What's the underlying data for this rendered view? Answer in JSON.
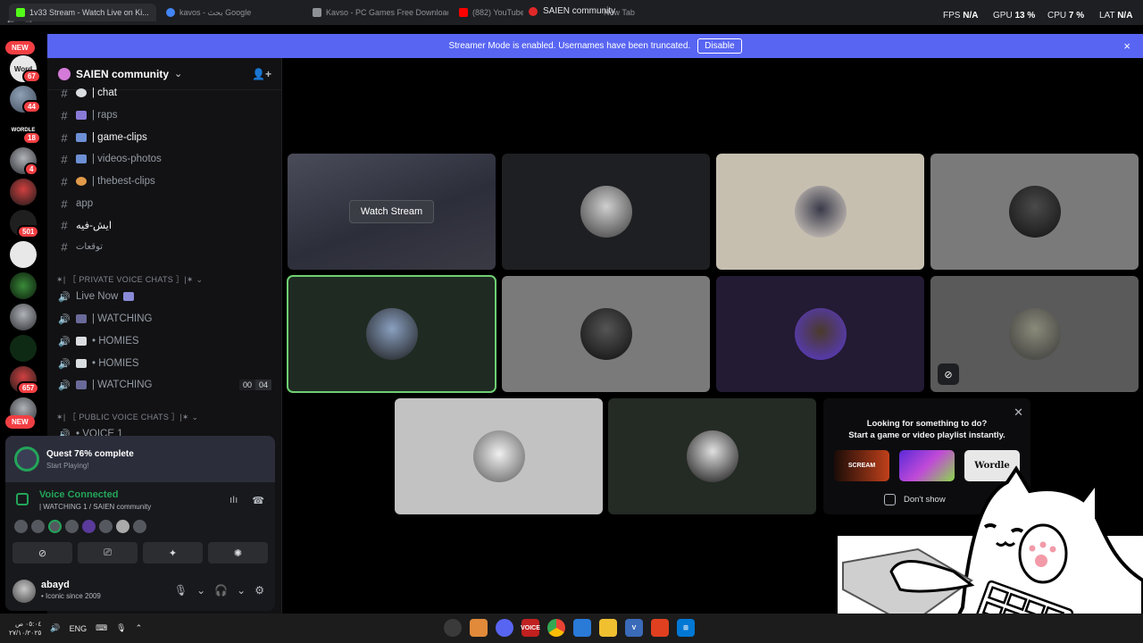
{
  "browser": {
    "tabs": [
      {
        "title": "1v33 Stream - Watch Live on Ki...",
        "color": "#53fc18"
      },
      {
        "title": "kavos - بحث Google",
        "color": "#4285f4"
      },
      {
        "title": "Kavso - PC Games Free Download",
        "color": "#8e9297"
      },
      {
        "title": "(882) YouTube",
        "color": "#ff0000"
      },
      {
        "title": "New Tab",
        "color": "#3a3d44"
      }
    ],
    "window_title": "SAIEN community",
    "stats": {
      "fps_label": "FPS",
      "fps_value": "N/A",
      "gpu_label": "GPU",
      "gpu_value": "13 %",
      "cpu_label": "CPU",
      "cpu_value": "7 %",
      "lat_label": "LAT",
      "lat_value": "N/A"
    }
  },
  "rail": {
    "new_label": "NEW",
    "badges": [
      "67",
      "44",
      "18",
      "4",
      "501",
      "657"
    ],
    "icon_labels": {
      "word": "Word",
      "wordle": "WORDLE"
    }
  },
  "banner": {
    "text": "Streamer Mode is enabled. Usernames have been truncated.",
    "button": "Disable",
    "close_icon": "×"
  },
  "server": {
    "name": "SAIEN community",
    "chevron": "⌄",
    "invite_icon": "👤+"
  },
  "channels": [
    {
      "name": "| chat",
      "type": "text",
      "bright": true
    },
    {
      "name": "| raps",
      "type": "text",
      "bright": false
    },
    {
      "name": "| game-clips",
      "type": "text",
      "bright": true
    },
    {
      "name": "| videos-photos",
      "type": "text",
      "bright": false
    },
    {
      "name": "| thebest-clips",
      "type": "text",
      "bright": false
    },
    {
      "name": "app",
      "type": "text",
      "bright": false
    },
    {
      "name": "ايش-فيه",
      "type": "text",
      "bright": true
    },
    {
      "name": "توقعات",
      "type": "text",
      "bright": false
    }
  ],
  "categories": {
    "private": "✶| ［ PRIVATE VOICE CHATS ］|✶",
    "public": "✶| ［ PUBLIC VOICE CHATS ］|✶"
  },
  "voice_channels": [
    {
      "name": "Live Now",
      "extra": ""
    },
    {
      "name": "| WATCHING",
      "extra": ""
    },
    {
      "name": "• HOMIES",
      "extra": ""
    },
    {
      "name": "• HOMIES",
      "extra": ""
    },
    {
      "name": "| WATCHING",
      "extra": "counter"
    },
    {
      "name": "• VOICE 1",
      "extra": ""
    }
  ],
  "counter": {
    "a": "00",
    "b": "04"
  },
  "quest": {
    "title": "Quest 76% complete",
    "subtitle": "Start Playing!",
    "progress": 0.76
  },
  "voice": {
    "title": "Voice Connected",
    "subtitle": "| WATCHING 1 / SAIEN community"
  },
  "user": {
    "name": "abayd",
    "status": "• Iconic since 2009"
  },
  "stage": {
    "watch_label": "Watch Stream"
  },
  "promo": {
    "title": "Looking for something to do?",
    "subtitle": "Start a game or video playlist instantly.",
    "games": [
      {
        "label": "SCREAM",
        "color": "#3a1a12"
      },
      {
        "label": "",
        "color": "#8a3ad8"
      },
      {
        "label": "Wordle",
        "color": "#e8e8e8"
      }
    ],
    "checkbox_label": "Don't show"
  },
  "taskbar": {
    "lang": "ENG",
    "time": "٠٥:٠٤ ص",
    "date": "٢٧/١٠/٢٠٢٥",
    "voicemeeter_label": "VOICE"
  }
}
